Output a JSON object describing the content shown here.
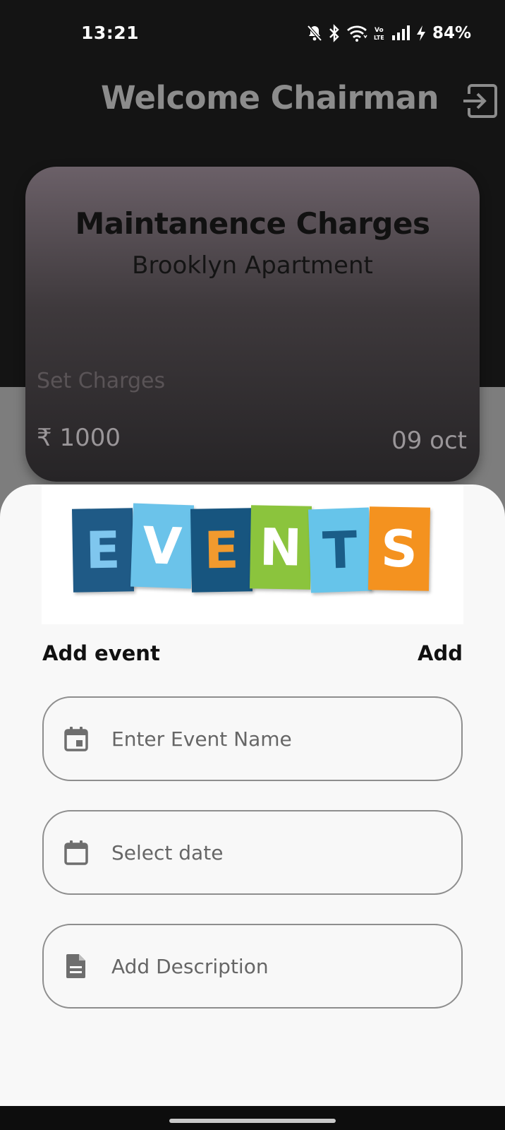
{
  "status_bar": {
    "time": "13:21",
    "battery": "84%",
    "icons": [
      "bell-off-icon",
      "bluetooth-icon",
      "wifi-icon",
      "volte-icon",
      "signal-icon",
      "charging-icon"
    ]
  },
  "header": {
    "title": "Welcome Chairman",
    "logout_icon": "logout-icon"
  },
  "card": {
    "title": "Maintanence Charges",
    "subtitle": "Brooklyn Apartment",
    "set_label": "Set Charges",
    "amount": "₹ 1000",
    "date": "09 oct"
  },
  "sheet": {
    "banner_letters": [
      "E",
      "V",
      "E",
      "N",
      "T",
      "S"
    ],
    "add_event_label": "Add event",
    "add_button": "Add",
    "fields": {
      "event_name": {
        "placeholder": "Enter Event Name",
        "icon": "calendar-event-icon"
      },
      "date": {
        "placeholder": "Select date",
        "icon": "calendar-icon"
      },
      "description": {
        "placeholder": "Add Description",
        "icon": "document-icon"
      }
    }
  },
  "colors": {
    "background_dark": "#141414",
    "background_mid": "#7d7d7d",
    "sheet": "#f8f8f8",
    "header_text": "#8c8c8c",
    "field_border": "#8e8e8e"
  }
}
